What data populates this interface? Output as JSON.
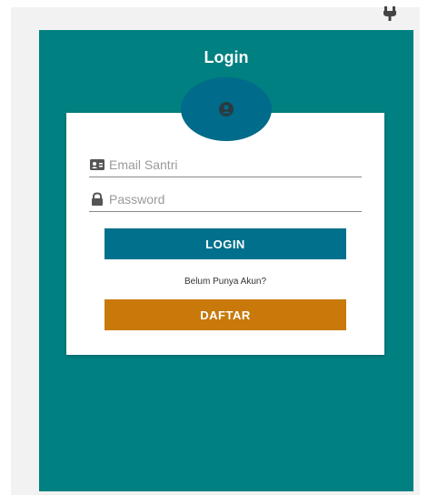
{
  "header": {
    "title": "Login"
  },
  "form": {
    "email_placeholder": "Email Santri",
    "password_placeholder": "Password",
    "login_label": "LOGIN",
    "register_prompt": "Belum Punya Akun?",
    "register_label": "DAFTAR"
  },
  "colors": {
    "background": "#008080",
    "avatar": "#006b8a",
    "login_button": "#00708c",
    "register_button": "#c8790a"
  },
  "icons": {
    "top": "plug-icon",
    "avatar": "user-circle-icon",
    "email": "id-card-icon",
    "password": "lock-icon"
  }
}
